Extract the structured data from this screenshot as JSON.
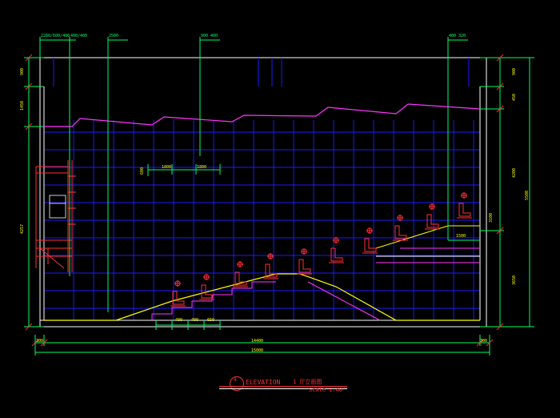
{
  "drawing": {
    "colors": {
      "background": "#000000",
      "grid": "#1a1aff",
      "dimension": "#00ff66",
      "outline": "#ffffff",
      "ceiling": "#ff33ff",
      "seats": "#ff3030",
      "floor": "#ffff00"
    },
    "top_labels": [
      "2280/600/400",
      "400/400",
      "2500",
      "900 400",
      "400 320"
    ],
    "left_dims": [
      "900",
      "1450",
      "4257"
    ],
    "right_dims": [
      "900",
      "450",
      "4200",
      "5500",
      "3100",
      "3650"
    ],
    "interior": {
      "level_marks": [
        "1800",
        "1800",
        "600"
      ],
      "step_dims": [
        "400",
        "400",
        "650"
      ],
      "upper_dim": "1500"
    },
    "bottom": {
      "side_left": "300",
      "overall": "14400",
      "side_right": "300",
      "total": "15000"
    },
    "title": {
      "number": "4",
      "main": "ELEVATION",
      "chinese": "1 厅立面图",
      "scale": "Scale 1:40"
    }
  }
}
